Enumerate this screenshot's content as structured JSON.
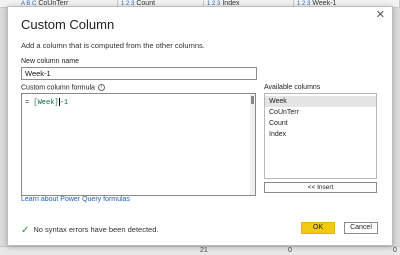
{
  "background": {
    "columns": [
      {
        "icon": "A B C",
        "label": "CoUnTerr"
      },
      {
        "icon": "1 2 3",
        "label": "Count"
      },
      {
        "icon": "1 2 3",
        "label": "Index"
      },
      {
        "icon": "1 2 3",
        "label": "Week-1"
      }
    ],
    "footer_values": [
      "21",
      "0",
      "0"
    ]
  },
  "dialog": {
    "title": "Custom Column",
    "description": "Add a column that is computed from the other columns.",
    "close_glyph": "✕",
    "new_column_name_label": "New column name",
    "new_column_name_value": "Week-1",
    "formula_label": "Custom column formula",
    "info_glyph": "i",
    "formula": {
      "prefix": "=",
      "column": "[Week]",
      "operator": "-",
      "number": "1"
    },
    "available_columns_label": "Available columns",
    "available_columns": [
      "Week",
      "CoUnTerr",
      "Count",
      "Index"
    ],
    "selected_column": "Week",
    "insert_label": "<< Insert",
    "learn_link": "Learn about Power Query formulas",
    "status_glyph": "✓",
    "status_text": "No syntax errors have been detected.",
    "ok_label": "OK",
    "cancel_label": "Cancel"
  },
  "colors": {
    "accent": "#f2c811",
    "link": "#1f5fad",
    "success": "#2d8c3c"
  }
}
